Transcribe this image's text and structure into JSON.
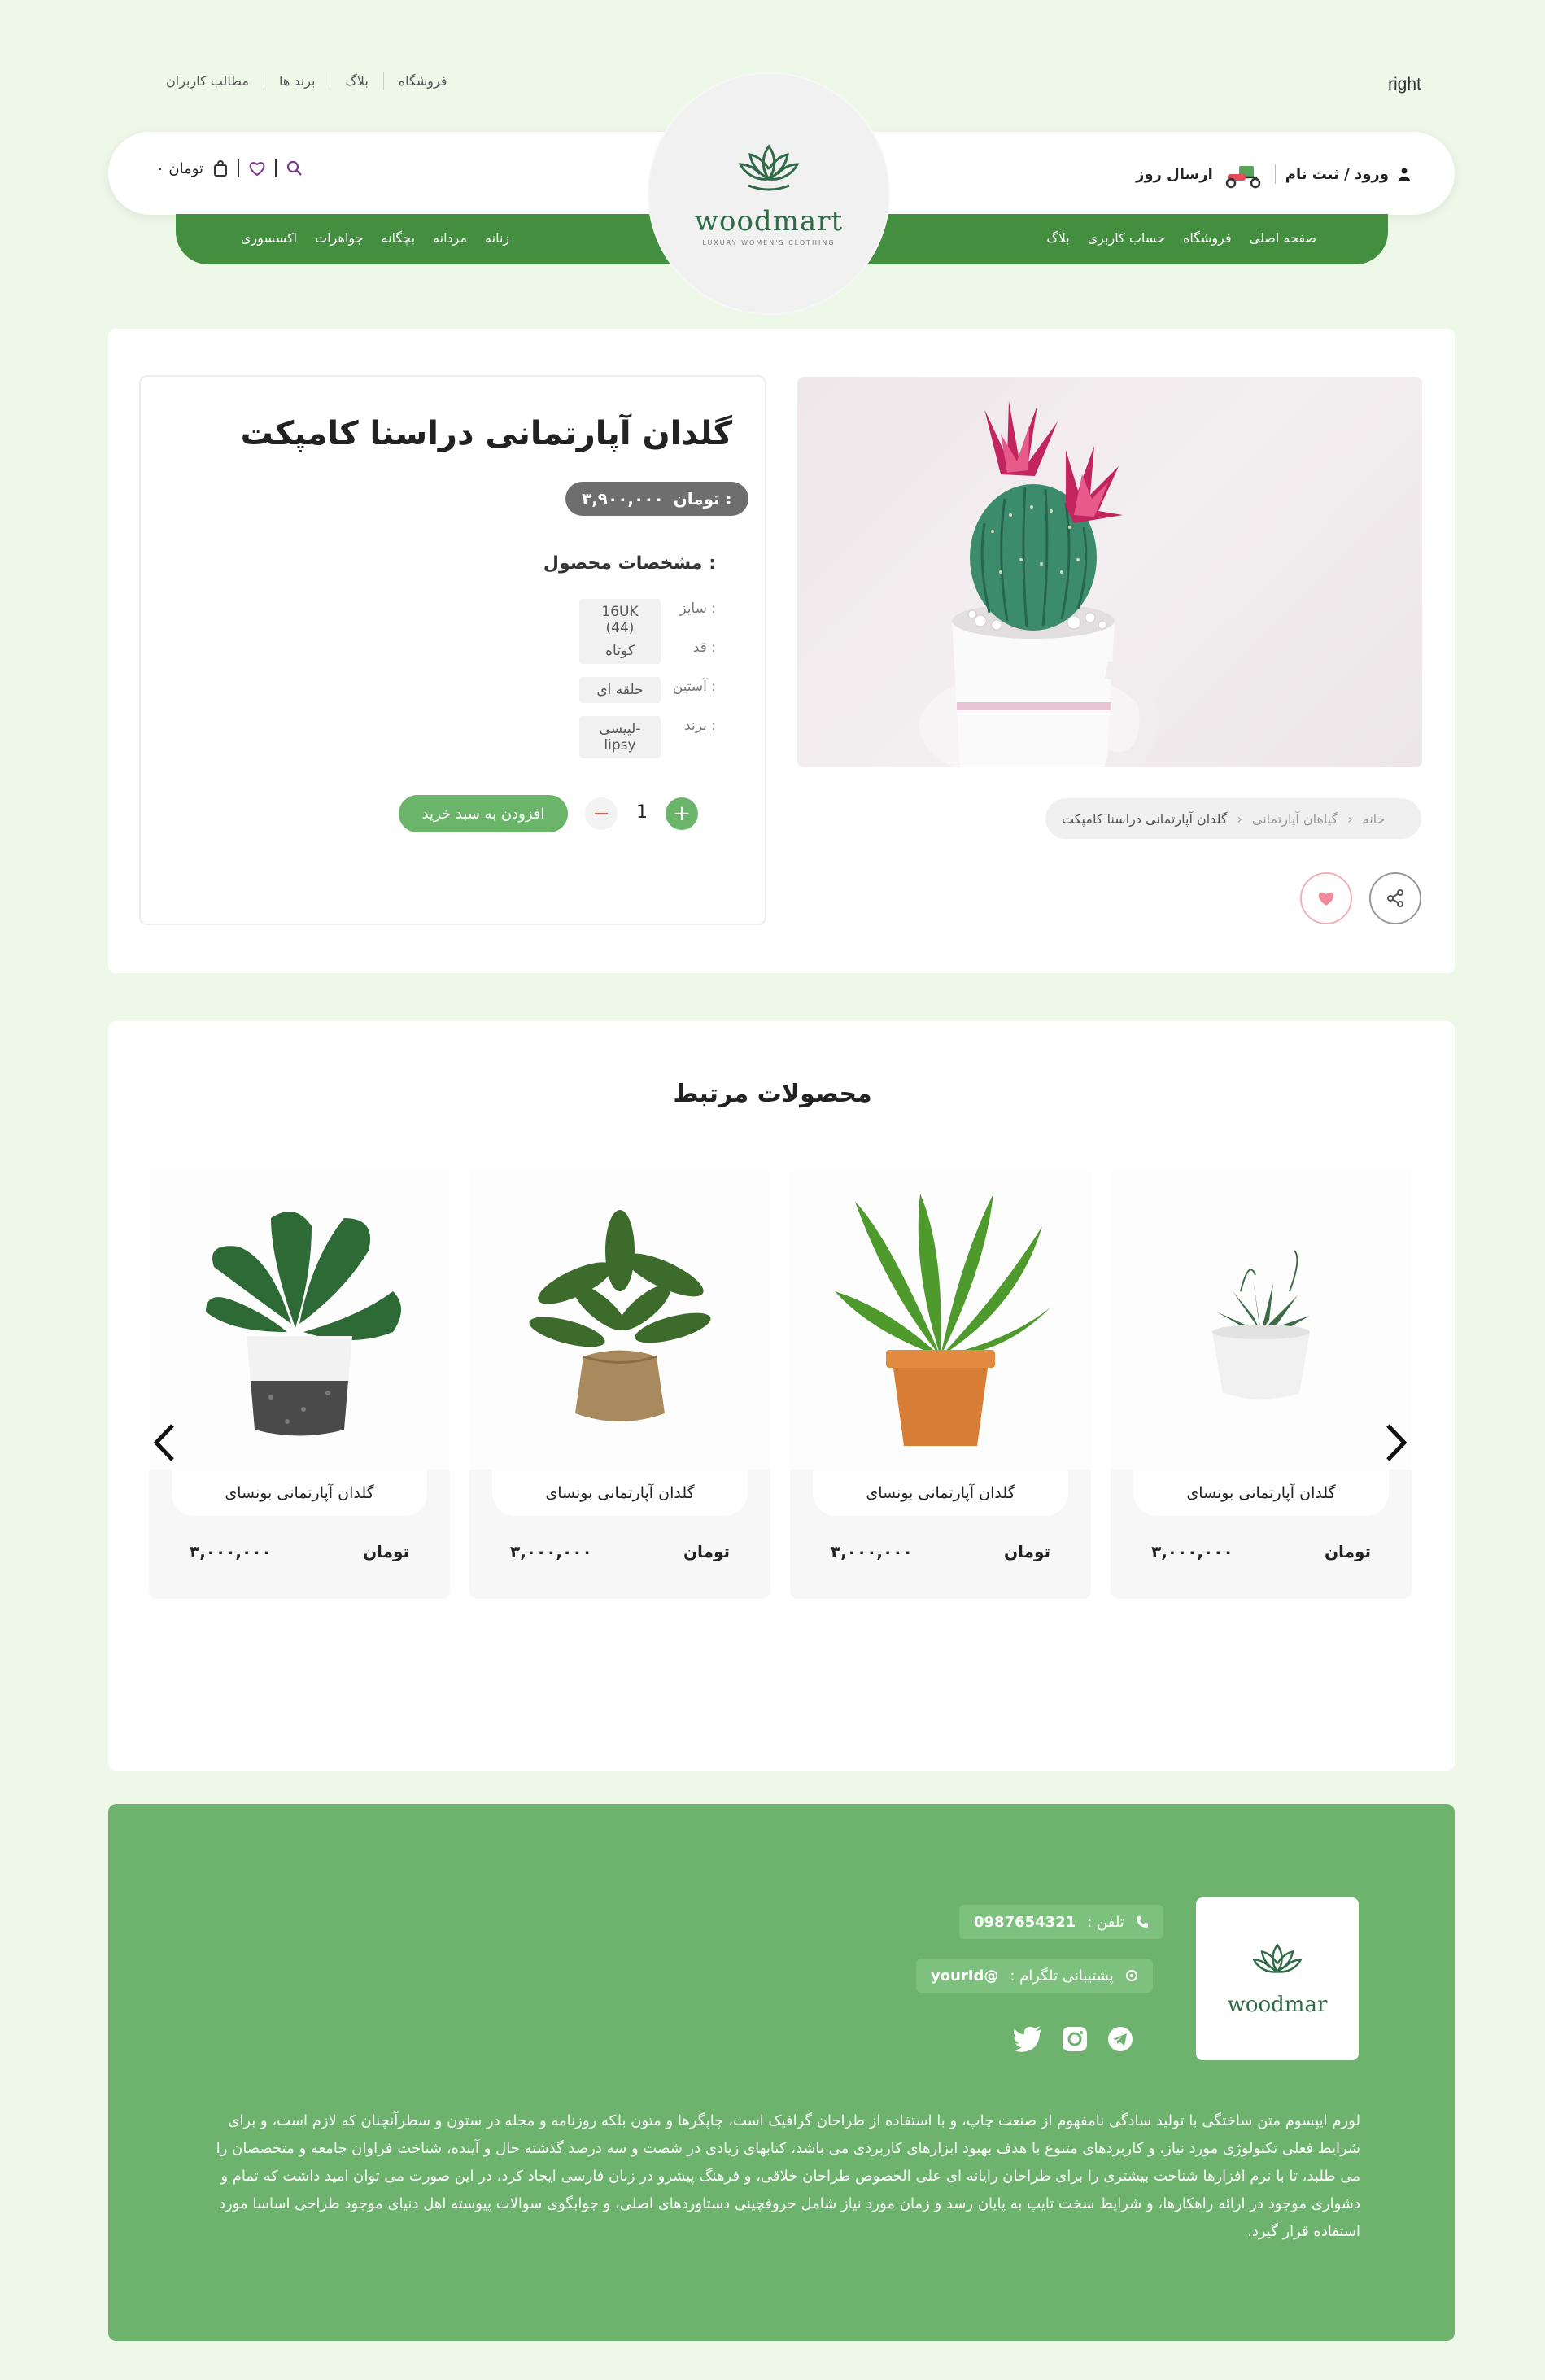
{
  "top_links": [
    "فروشگاه",
    "بلاگ",
    "برند ها",
    "مطالب کاربران"
  ],
  "top_right_word": "right",
  "header": {
    "login_label": "ورود / ثبت نام",
    "delivery_label": "ارسال روز",
    "cart_amount": "۰ تومان"
  },
  "logo": {
    "text": "woodmart",
    "tagline": "LUXURY WOMEN'S CLOTHING"
  },
  "nav_right": [
    "صفحه اصلی",
    "فروشگاه",
    "حساب کاربری",
    "بلاگ"
  ],
  "nav_left": [
    "زنانه",
    "مردانه",
    "بچگانه",
    "جواهرات",
    "اکسسوری"
  ],
  "product": {
    "title": "گلدان آپارتمانی دراسنا کامپکت",
    "price": "۳,۹۰۰,۰۰۰",
    "currency": "تومان :",
    "specs_title": "مشخصات محصول :",
    "specs": [
      {
        "label": "سایز :",
        "value": "16UK (44)"
      },
      {
        "label": "قد :",
        "value": "کوتاه"
      },
      {
        "label": "آستین :",
        "value": "حلقه ای"
      },
      {
        "label": "برند :",
        "value": "لیپسی-lipsy"
      }
    ],
    "quantity": "1",
    "add_to_cart": "افزودن به سبد خرید"
  },
  "breadcrumb": [
    "خانه",
    "گیاهان آپارتمانی",
    "گلدان آپارتمانی دراسنا کامپکت"
  ],
  "related": {
    "title": "محصولات مرتبط",
    "items": [
      {
        "name": "گلدان آپارتمانی بونسای",
        "price": "۳,۰۰۰,۰۰۰",
        "currency": "تومان"
      },
      {
        "name": "گلدان آپارتمانی بونسای",
        "price": "۳,۰۰۰,۰۰۰",
        "currency": "تومان"
      },
      {
        "name": "گلدان آپارتمانی بونسای",
        "price": "۳,۰۰۰,۰۰۰",
        "currency": "تومان"
      },
      {
        "name": "گلدان آپارتمانی بونسای",
        "price": "۳,۰۰۰,۰۰۰",
        "currency": "تومان"
      }
    ]
  },
  "footer": {
    "phone_label": "تلفن :",
    "phone": "0987654321",
    "telegram_label": "پشتیبانی تلگرام :",
    "telegram": "@yourId",
    "logo_text": "woodmar",
    "description": "لورم ایپسوم متن ساختگی با تولید سادگی نامفهوم از صنعت چاپ، و با استفاده از طراحان گرافیک است، چاپگرها و متون بلکه روزنامه و مجله در ستون و سطرآنچنان که لازم است، و برای شرایط فعلی تکنولوژی مورد نیاز، و کاربردهای متنوع با هدف بهبود ابزارهای کاربردی می باشد، کتابهای زیادی در شصت و سه درصد گذشته حال و آینده، شناخت فراوان جامعه و متخصصان را می طلبد، تا با نرم افزارها شناخت بیشتری را برای طراحان رایانه ای علی الخصوص طراحان خلاقی، و فرهنگ پیشرو در زبان فارسی ایجاد کرد، در این صورت می توان امید داشت که تمام و دشواری موجود در ارائه راهکارها، و شرایط سخت تایپ به پایان رسد و زمان مورد نیاز شامل حروفچینی دستاوردهای اصلی، و جوابگوی سوالات پیوسته اهل دنیای موجود طراحی اساسا مورد استفاده قرار گیرد."
  },
  "colors": {
    "primary_green": "#438f3f",
    "footer_green": "#6db36d",
    "background": "#eef8e8",
    "button_green": "#6ab56a"
  }
}
